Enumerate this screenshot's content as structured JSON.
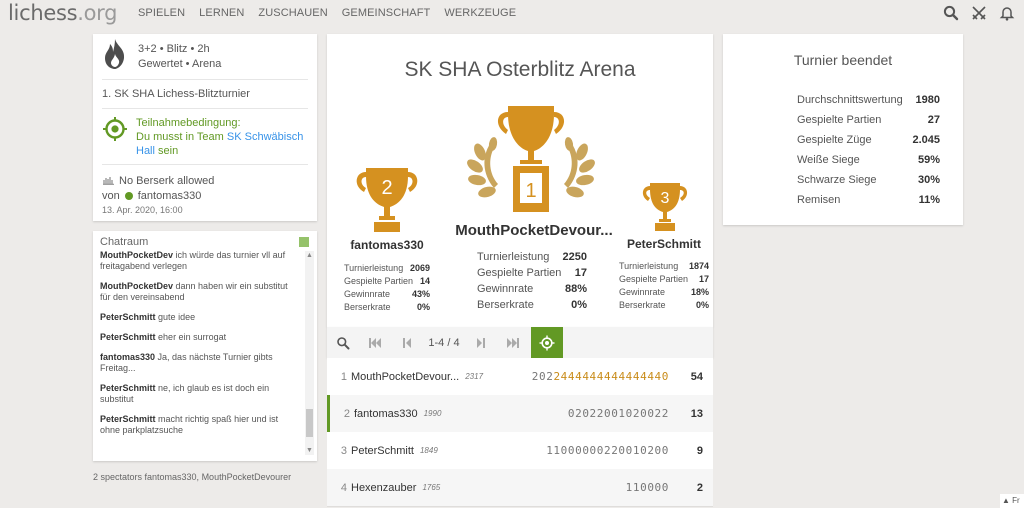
{
  "header": {
    "logo_main": "lichess",
    "logo_tld": ".org",
    "nav": [
      "SPIELEN",
      "LERNEN",
      "ZUSCHAUEN",
      "GEMEINSCHAFT",
      "WERKZEUGE"
    ]
  },
  "tournament": {
    "clock_line": "3+2 • Blitz • 2h",
    "mode_line": "Gewertet • Arena",
    "name": "1. SK SHA Lichess-Blitzturnier",
    "cond_label": "Teilnahmebedingung:",
    "cond_text": "Du musst in Team",
    "cond_team": "SK Schwäbisch Hall",
    "cond_suffix": "sein",
    "berserk": "No Berserk allowed",
    "by_label": "von",
    "creator": "fantomas330",
    "date": "13. Apr. 2020, 16:00"
  },
  "chat": {
    "title": "Chatraum",
    "messages": [
      {
        "user": "MouthPocketDev",
        "text": "ich würde das turnier vll auf freitagabend verlegen"
      },
      {
        "user": "MouthPocketDev",
        "text": "dann haben wir ein substitut für den vereinsabend"
      },
      {
        "user": "PeterSchmitt",
        "text": "gute idee"
      },
      {
        "user": "PeterSchmitt",
        "text": "eher ein surrogat"
      },
      {
        "user": "fantomas330",
        "text": "Ja, das nächste Turnier gibts Freitag..."
      },
      {
        "user": "PeterSchmitt",
        "text": "ne, ich glaub es ist doch ein substitut"
      },
      {
        "user": "PeterSchmitt",
        "text": "macht richtig spaß hier und ist ohne parkplatzsuche"
      }
    ]
  },
  "spectators": "2 spectators fantomas330, MouthPocketDevourer",
  "podium": {
    "title": "SK SHA Osterblitz Arena",
    "first": {
      "rank": "1",
      "name": "MouthPocketDevour...",
      "stats": [
        [
          "Turnierleistung",
          "2250"
        ],
        [
          "Gespielte Partien",
          "17"
        ],
        [
          "Gewinnrate",
          "88%"
        ],
        [
          "Berserkrate",
          "0%"
        ]
      ]
    },
    "second": {
      "rank": "2",
      "name": "fantomas330",
      "stats": [
        [
          "Turnierleistung",
          "2069"
        ],
        [
          "Gespielte Partien",
          "14"
        ],
        [
          "Gewinnrate",
          "43%"
        ],
        [
          "Berserkrate",
          "0%"
        ]
      ]
    },
    "third": {
      "rank": "3",
      "name": "PeterSchmitt",
      "stats": [
        [
          "Turnierleistung",
          "1874"
        ],
        [
          "Gespielte Partien",
          "17"
        ],
        [
          "Gewinnrate",
          "18%"
        ],
        [
          "Berserkrate",
          "0%"
        ]
      ]
    }
  },
  "pager": {
    "label": "1-4 / 4"
  },
  "standings": [
    {
      "rank": "1",
      "name": "MouthPocketDevour...",
      "rating": "2317",
      "sheet_plain": "202",
      "sheet_fire": "2444444444444440",
      "total": "54"
    },
    {
      "rank": "2",
      "name": "fantomas330",
      "rating": "1990",
      "sheet_plain": "02022001020022",
      "sheet_fire": "",
      "total": "13"
    },
    {
      "rank": "3",
      "name": "PeterSchmitt",
      "rating": "1849",
      "sheet_plain": "11000000220010200",
      "sheet_fire": "",
      "total": "9"
    },
    {
      "rank": "4",
      "name": "Hexenzauber",
      "rating": "1765",
      "sheet_plain": "110000",
      "sheet_fire": "",
      "total": "2"
    }
  ],
  "ended": {
    "title": "Turnier beendet",
    "rows": [
      [
        "Durchschnittswertung",
        "1980"
      ],
      [
        "Gespielte Partien",
        "27"
      ],
      [
        "Gespielte Züge",
        "2.045"
      ],
      [
        "Weiße Siege",
        "59%"
      ],
      [
        "Schwarze Siege",
        "30%"
      ],
      [
        "Remisen",
        "11%"
      ]
    ]
  },
  "lang_button": "Fr",
  "colors": {
    "accent_green": "#629924",
    "gold": "#d59120",
    "link_blue": "#3893e8"
  }
}
